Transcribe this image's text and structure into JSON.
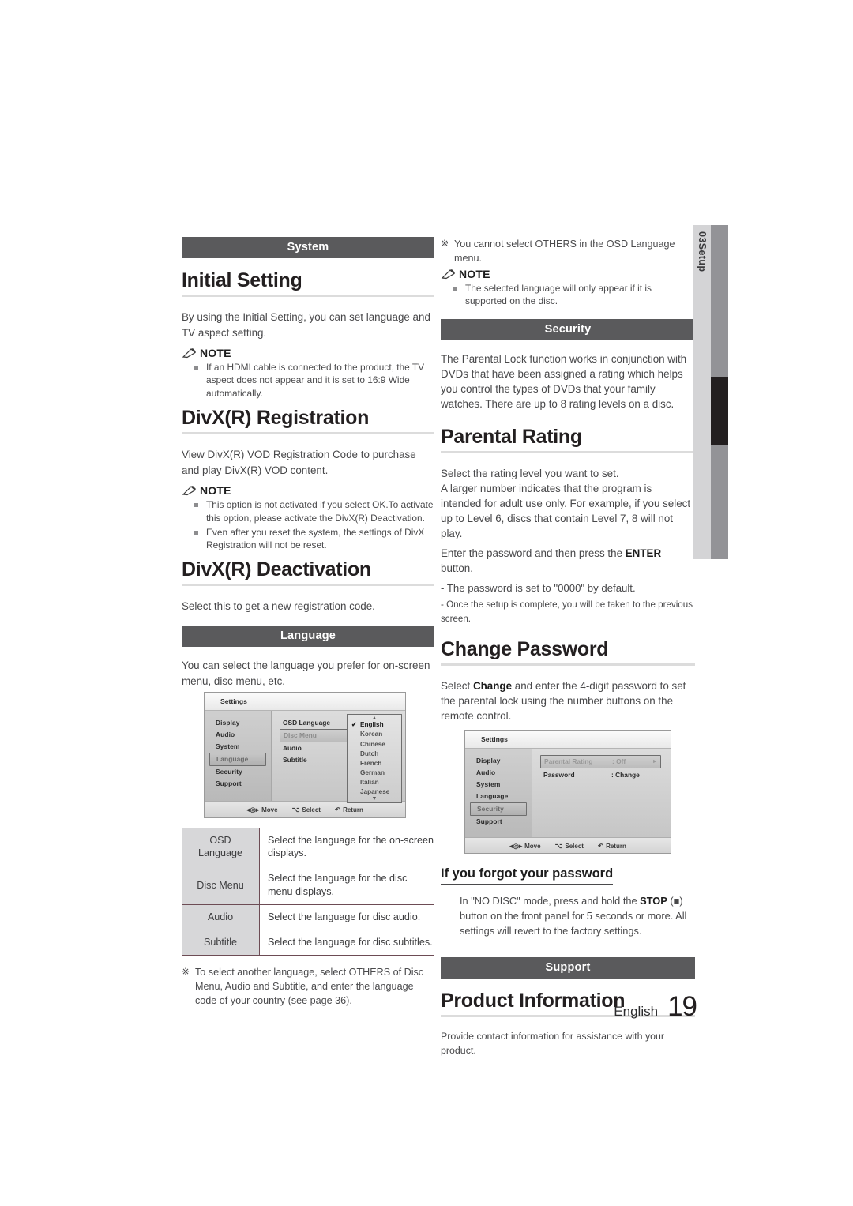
{
  "document": {
    "chapter_tab": {
      "number": "03",
      "label": "Setup"
    },
    "footer": {
      "language": "English",
      "page": "19"
    }
  },
  "left_column": {
    "band_system": "System",
    "initial_setting": {
      "heading": "Initial Setting",
      "body": "By using the Initial Setting, you can set language and TV aspect setting.",
      "note_label": "NOTE",
      "notes": [
        "If an HDMI cable is connected to the product, the TV aspect does not appear and it is set to 16:9 Wide automatically."
      ]
    },
    "divx_registration": {
      "heading": "DivX(R) Registration",
      "body": "View DivX(R) VOD Registration Code to purchase and play DivX(R) VOD content.",
      "note_label": "NOTE",
      "notes": [
        "This option is not activated if you select OK.To activate this option, please activate the DivX(R) Deactivation.",
        "Even after you reset the system, the settings of DivX Registration will not be reset."
      ]
    },
    "divx_deactivation": {
      "heading": "DivX(R) Deactivation",
      "body": "Select this to get a new registration code."
    },
    "band_language": "Language",
    "language": {
      "body": "You can select the language you prefer for on-screen menu, disc menu, etc.",
      "table": {
        "rows": [
          {
            "key": "OSD Language",
            "value": "Select the language for the on-screen displays."
          },
          {
            "key": "Disc Menu",
            "value": "Select the language for the disc menu displays."
          },
          {
            "key": "Audio",
            "value": "Select the language for disc audio."
          },
          {
            "key": "Subtitle",
            "value": "Select the language for disc subtitles."
          }
        ]
      },
      "star_note": "To select another language, select OTHERS of Disc Menu, Audio and Subtitle, and enter the language code of your country (see page 36)."
    },
    "osd_language_screen": {
      "title": "Settings",
      "menu_left": [
        "Display",
        "Audio",
        "System",
        "Language",
        "Security",
        "Support"
      ],
      "menu_left_selected": "Language",
      "menu_mid": [
        "OSD Language",
        "Disc Menu",
        "Audio",
        "Subtitle"
      ],
      "menu_mid_selected": "Disc Menu",
      "options": [
        "English",
        "Korean",
        "Chinese",
        "Dutch",
        "French",
        "German",
        "Italian",
        "Japanese"
      ],
      "option_checked": "English",
      "footer": {
        "move": "Move",
        "select": "Select",
        "return": "Return"
      }
    }
  },
  "right_column": {
    "star_note_osd": "You cannot select OTHERS in the OSD Language menu.",
    "note_label": "NOTE",
    "notes": [
      "The selected language will only appear if it is supported on the disc."
    ],
    "band_security": "Security",
    "security_intro": "The Parental Lock function works in conjunction with DVDs that have been assigned a rating which helps you control the types of DVDs that your family watches. There are up to 8 rating levels on a disc.",
    "parental_rating": {
      "heading": "Parental Rating",
      "body1": "Select the rating level you want to set.",
      "body2": "A larger number indicates that the program is intended for adult use only. For example, if you select up to Level 6, discs that contain Level 7, 8 will not play.",
      "body3_pre": "Enter the password and then press the ",
      "body3_bold": "ENTER",
      "body3_post": " button.",
      "dash1": "- The password is set to \"0000\" by default.",
      "dash2": "- Once the setup is complete, you will be taken to the previous screen."
    },
    "change_password": {
      "heading": "Change Password",
      "body_pre": "Select ",
      "body_bold": "Change",
      "body_post": " and enter the 4-digit password to set the parental lock using the number buttons on the remote control."
    },
    "security_screen": {
      "title": "Settings",
      "menu_left": [
        "Display",
        "Audio",
        "System",
        "Language",
        "Security",
        "Support"
      ],
      "menu_left_selected": "Security",
      "rows": [
        {
          "key": "Parental Rating",
          "value": ": Off",
          "selected": true
        },
        {
          "key": "Password",
          "value": ": Change",
          "selected": false
        }
      ],
      "footer": {
        "move": "Move",
        "select": "Select",
        "return": "Return"
      }
    },
    "forgot_password": {
      "heading": "If you forgot your password",
      "body_pre": "In \"NO DISC\" mode, press and hold the ",
      "body_bold": "STOP",
      "body_mid": " (■) button on the front panel for 5 seconds or more. All settings will revert to the factory settings."
    },
    "band_support": "Support",
    "product_information": {
      "heading": "Product Information",
      "body": "Provide contact information for assistance with your product."
    }
  }
}
